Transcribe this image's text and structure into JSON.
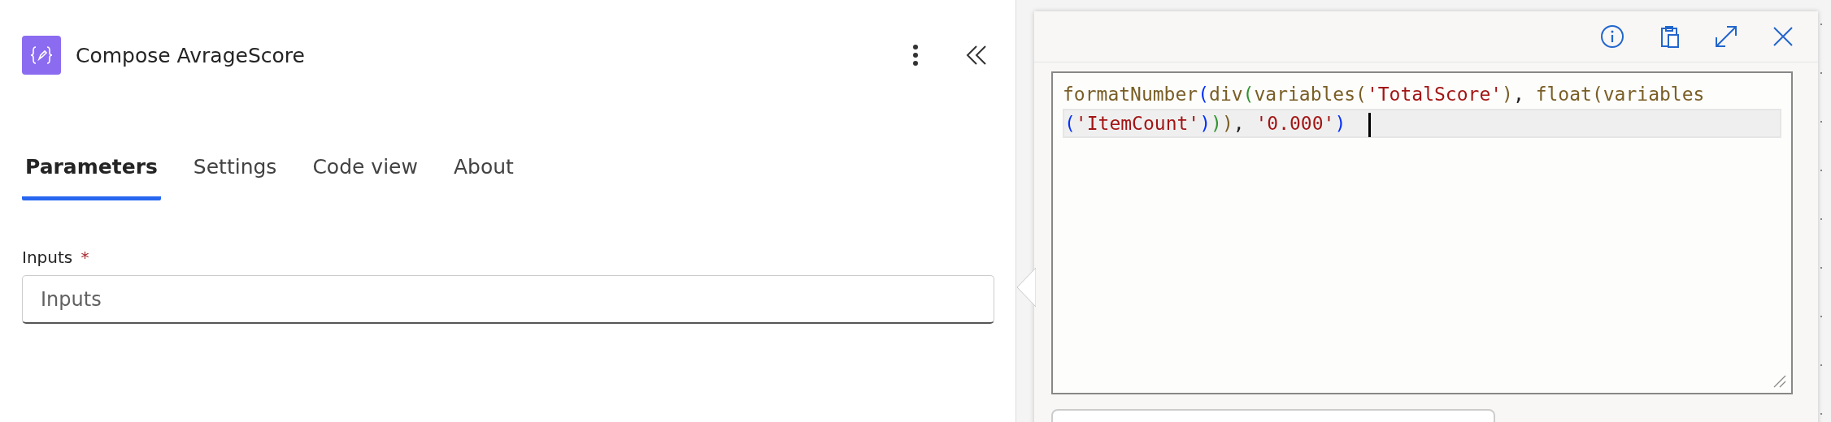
{
  "panel": {
    "title": "Compose AvrageScore",
    "tabs": [
      {
        "label": "Parameters",
        "selected": true
      },
      {
        "label": "Settings",
        "selected": false
      },
      {
        "label": "Code view",
        "selected": false
      },
      {
        "label": "About",
        "selected": false
      }
    ],
    "field": {
      "label": "Inputs",
      "required_mark": "*",
      "placeholder": "Inputs"
    }
  },
  "expression_editor": {
    "lines": [
      {
        "current": false,
        "tokens": [
          {
            "kind": "function",
            "text": "formatNumber"
          },
          {
            "kind": "bracket1",
            "text": "("
          },
          {
            "kind": "function",
            "text": "div"
          },
          {
            "kind": "bracket2",
            "text": "("
          },
          {
            "kind": "function",
            "text": "variables("
          },
          {
            "kind": "string",
            "text": "'TotalScore'"
          },
          {
            "kind": "function",
            "text": ")"
          },
          {
            "kind": "plain",
            "text": ", "
          },
          {
            "kind": "function",
            "text": "float(variables"
          }
        ]
      },
      {
        "current": true,
        "tokens": [
          {
            "kind": "bracket1",
            "text": "("
          },
          {
            "kind": "string",
            "text": "'ItemCount'"
          },
          {
            "kind": "bracket1",
            "text": ")"
          },
          {
            "kind": "bracket2",
            "text": ")"
          },
          {
            "kind": "function",
            "text": ")"
          },
          {
            "kind": "plain",
            "text": ", "
          },
          {
            "kind": "string",
            "text": "'0.000'"
          },
          {
            "kind": "bracket1",
            "text": ")"
          }
        ]
      }
    ]
  }
}
